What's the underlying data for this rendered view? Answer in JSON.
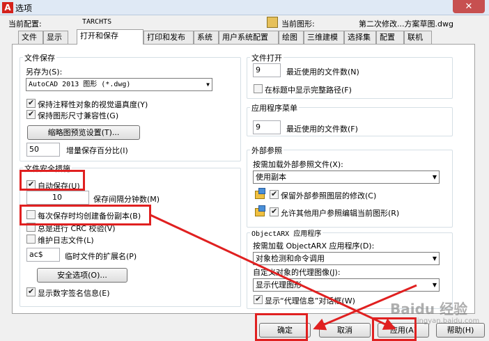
{
  "window": {
    "title": "选项",
    "close": "✕"
  },
  "header": {
    "profile_label": "当前配置:",
    "profile_value": "TARCHTS",
    "drawing_label": "当前图形:",
    "drawing_value": "第二次修改...方案草图.dwg"
  },
  "tabs": [
    "文件",
    "显示",
    "打开和保存",
    "打印和发布",
    "系统",
    "用户系统配置",
    "绘图",
    "三维建模",
    "选择集",
    "配置",
    "联机"
  ],
  "active_tab": "打开和保存",
  "file_save": {
    "title": "文件保存",
    "save_as_label": "另存为(S):",
    "save_as_value": "AutoCAD 2013 图形 (*.dwg)",
    "maintain_visual": "保持注释性对象的视觉逼真度(Y)",
    "maintain_size": "保持图形尺寸兼容性(G)",
    "thumbnail_button": "缩略图预览设置(T)...",
    "incremental_value": "50",
    "incremental_label": "增量保存百分比(I)"
  },
  "file_safety": {
    "title": "文件安全措施",
    "autosave": "自动保存(U)",
    "minutes_value": "10",
    "minutes_label": "保存间隔分钟数(M)",
    "backup": "每次保存时均创建备份副本(B)",
    "crc": "总是进行 CRC 校验(V)",
    "log": "维护日志文件(L)",
    "temp_ext_value": "ac$",
    "temp_ext_label": "临时文件的扩展名(P)",
    "security_button": "安全选项(O)...",
    "digital_sig": "显示数字签名信息(E)"
  },
  "file_open": {
    "title": "文件打开",
    "recent_value": "9",
    "recent_label": "最近使用的文件数(N)",
    "full_path": "在标题中显示完整路径(F)"
  },
  "app_menu": {
    "title": "应用程序菜单",
    "recent_value": "9",
    "recent_label": "最近使用的文件数(F)"
  },
  "xref": {
    "title": "外部参照",
    "demand_label": "按需加载外部参照文件(X):",
    "demand_value": "使用副本",
    "retain_changes": "保留外部参照图层的修改(C)",
    "allow_edit": "允许其他用户参照编辑当前图形(R)"
  },
  "objectarx": {
    "title": "ObjectARX 应用程序",
    "demand_label": "按需加载 ObjectARX 应用程序(D):",
    "demand_value": "对象检测和命令调用",
    "proxy_label": "自定义对象的代理图像(J):",
    "proxy_value": "显示代理图形",
    "proxy_info": "显示“代理信息”对话框(W)"
  },
  "buttons": {
    "ok": "确定",
    "cancel": "取消",
    "apply": "应用(A)",
    "help": "帮助(H)"
  },
  "watermark": {
    "text": "Baidu 经验",
    "sub": "jingyan.baidu.com"
  },
  "annotation_color": "#e02020"
}
